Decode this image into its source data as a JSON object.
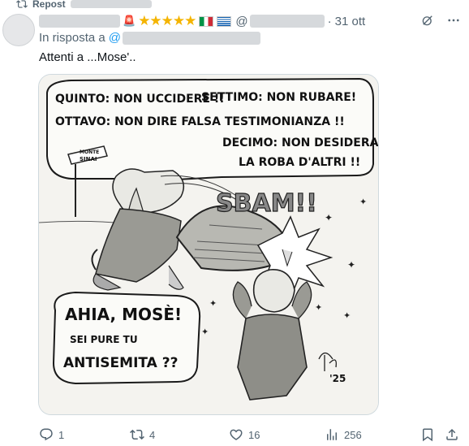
{
  "repost": {
    "label": "Repost"
  },
  "tweet": {
    "name_emoji": "🚨",
    "stars": "★★★★★",
    "handle_at": "@",
    "dot": "·",
    "time": "31 ott",
    "reply_prefix": "In risposta a",
    "reply_at": "@",
    "text": "Attenti a ...Mose'.."
  },
  "comic": {
    "bubble_top_line1a": "QUINTO: NON UCCIDERE !!",
    "bubble_top_line1b": "SETTIMO: NON RUBARE!",
    "bubble_top_line2": "OTTAVO: NON DIRE FALSA TESTIMONIANZA !!",
    "bubble_top_line3": "DECIMO: NON DESIDERARE",
    "bubble_top_line4": "LA ROBA D'ALTRI !!",
    "sign_line1": "MONTE",
    "sign_line2": "SINAI",
    "sound": "SBAM!!",
    "bubble_bottom_line1": "AHIA, MOSÈ!",
    "bubble_bottom_line2": "SEI PURE TU",
    "bubble_bottom_line3": "ANTISEMITA ??",
    "signature_year": "'25"
  },
  "footer": {
    "replies": "1",
    "reposts": "4",
    "likes": "16",
    "views": "256"
  }
}
